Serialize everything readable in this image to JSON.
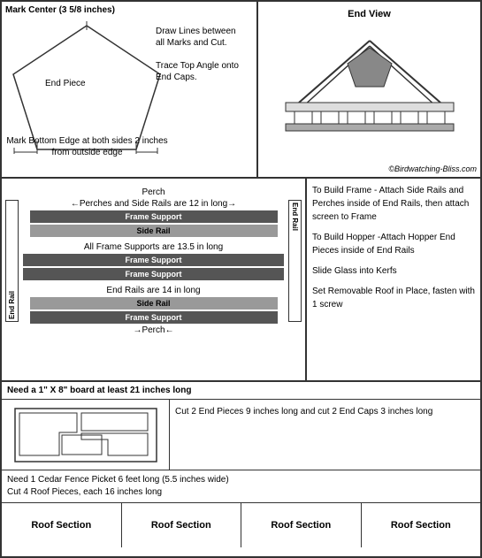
{
  "top": {
    "mark_center": "Mark Center (3 5/8 inches)",
    "draw_lines": "Draw Lines between all Marks and Cut.",
    "trace_angle": "Trace Top Angle onto End Caps.",
    "end_piece": "End Piece",
    "bottom_mark": "Mark Bottom Edge at both sides\n2 inches from outside edge",
    "end_view": "End View",
    "copyright": "©Birdwatching-Bliss.com"
  },
  "middle": {
    "perch_label": "Perch",
    "perches_side_rails": "Perches and Side Rails are 12 in long",
    "frame_support1": "Frame Support",
    "side_rail1": "Side Rail",
    "all_frame_supports": "All Frame Supports are 13.5 in long",
    "frame_support2": "Frame Support",
    "frame_support3": "Frame Support",
    "end_rails": "End Rails are 14 in long",
    "side_rail2": "Side Rail",
    "frame_support4": "Frame Support",
    "perch2": "Perch",
    "end_rail": "End Rail",
    "instructions1": "To Build Frame - Attach Side Rails and Perches inside of End Rails, then attach screen to Frame",
    "instructions2": "To Build Hopper -Attach Hopper End Pieces inside of End Rails",
    "instructions3": "Slide Glass into Kerfs",
    "instructions4": "Set Removable Roof in Place, fasten with 1 screw"
  },
  "bottom": {
    "board_info": "Need a 1\" X 8\" board at least 21 inches long",
    "cut_info": "Cut 2 End Pieces 9 inches long and cut 2 End Caps 3 inches long",
    "cedar_line1": "Need 1 Cedar Fence Picket 6 feet long (5.5 inches wide)",
    "cedar_line2": "Cut 4 Roof Pieces, each 16 inches long",
    "roof_sections": [
      "Roof Section",
      "Roof Section",
      "Roof Section",
      "Roof Section"
    ]
  }
}
